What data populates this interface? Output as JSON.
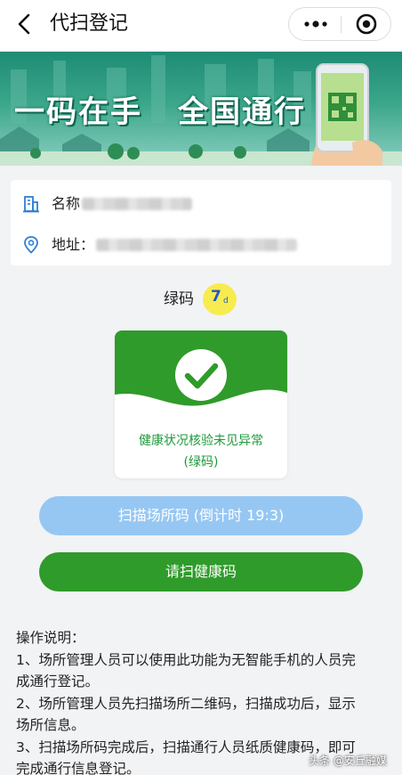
{
  "nav": {
    "title": "代扫登记",
    "back_icon": "chevron-left-icon",
    "more_icon": "more-dots-icon",
    "close_icon": "target-close-icon"
  },
  "banner": {
    "slogan_left": "一码在手",
    "slogan_right": "全国通行"
  },
  "venue": {
    "name_label": "名称",
    "address_label": "地址：",
    "name_icon": "building-icon",
    "address_icon": "location-pin-icon"
  },
  "status": {
    "label": "绿码",
    "days": "7",
    "days_unit": "d",
    "line1": "健康状况核验未见异常",
    "line2": "(绿码)",
    "check_icon": "check-circle-icon"
  },
  "buttons": {
    "scan_place": "扫描场所码 (倒计时 19:3)",
    "scan_health": "请扫健康码"
  },
  "instructions": {
    "title": "操作说明：",
    "lines": [
      "1、场所管理人员可以使用此功能为无智能手机的人员完",
      "成通行登记。",
      "2、场所管理人员先扫描场所二维码，扫描成功后，显示",
      "场所信息。",
      "3、扫描场所码完成后，扫描通行人员纸质健康码，即可",
      "完成通行信息登记。"
    ]
  },
  "watermark": "头条 @安丘融媒",
  "colors": {
    "green": "#2f9b2a",
    "light_blue": "#96c7f3",
    "badge_yellow": "#f6ec4f",
    "banner_teal": "#1e8b74"
  }
}
